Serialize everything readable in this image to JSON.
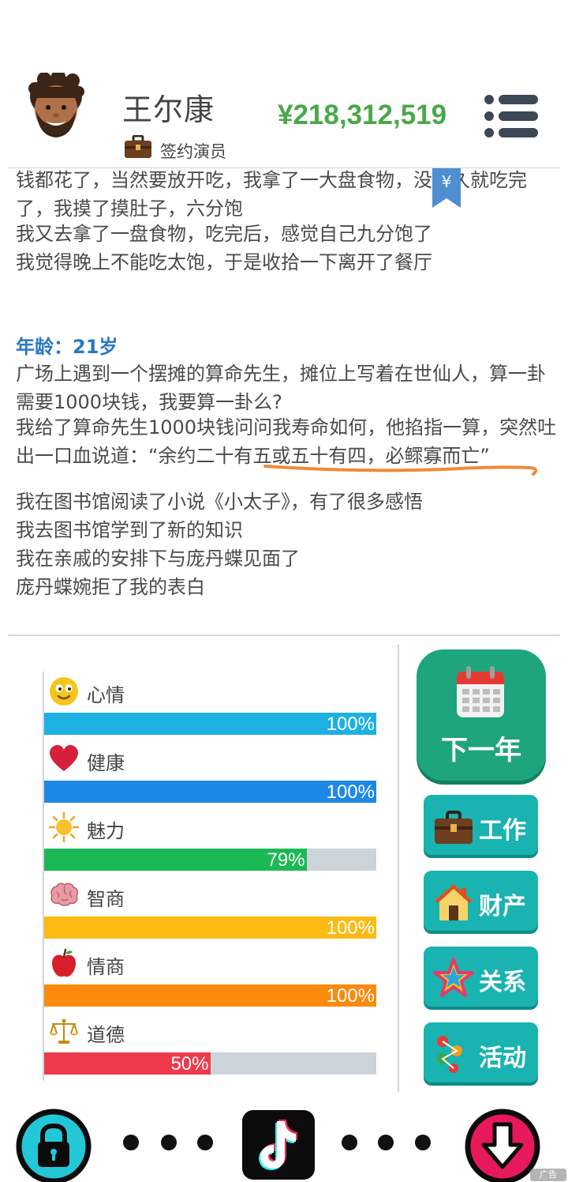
{
  "header": {
    "name": "王尔康",
    "job": "签约演员",
    "money": "¥218,312,519"
  },
  "log": {
    "bookmark_symbol": "¥",
    "line1": "钱都花了，当然要放开吃，我拿了一大盘食物，没多久就吃完了，我摸了摸肚子，六分饱",
    "line2": "我又去拿了一盘食物，吃完后，感觉自己九分饱了",
    "line3": "我觉得晚上不能吃太饱，于是收拾一下离开了餐厅",
    "age_label": "年龄：21岁",
    "line4": "广场上遇到一个摆摊的算命先生，摊位上写着在世仙人，算一卦需要1000块钱，我要算一卦么?",
    "line5": "我给了算命先生1000块钱问问我寿命如何，他掐指一算，突然吐出一口血说道：“余约二十有五或五十有四，必鳏寡而亡”",
    "line6": "我在图书馆阅读了小说《小太子》，有了很多感悟",
    "line7": "我去图书馆学到了新的知识",
    "line8": "我在亲戚的安排下与庞丹蝶见面了",
    "line9": "庞丹蝶婉拒了我的表白"
  },
  "stats": [
    {
      "key": "mood",
      "label": "心情",
      "value_text": "100%",
      "value": 100,
      "color": "#1eb0e0",
      "icon": "smiley-icon"
    },
    {
      "key": "health",
      "label": "健康",
      "value_text": "100%",
      "value": 100,
      "color": "#1e88e5",
      "icon": "heart-icon"
    },
    {
      "key": "charm",
      "label": "魅力",
      "value_text": "79%",
      "value": 79,
      "color": "#1bb954",
      "icon": "sun-icon"
    },
    {
      "key": "iq",
      "label": "智商",
      "value_text": "100%",
      "value": 100,
      "color": "#fbbb13",
      "icon": "brain-icon"
    },
    {
      "key": "eq",
      "label": "情商",
      "value_text": "100%",
      "value": 100,
      "color": "#fb8a0d",
      "icon": "apple-icon"
    },
    {
      "key": "morality",
      "label": "道德",
      "value_text": "50%",
      "value": 50,
      "color": "#ef3a4c",
      "icon": "scales-icon"
    }
  ],
  "actions": {
    "next_year": "下一年",
    "work": "工作",
    "property": "财产",
    "relations": "关系",
    "activities": "活动"
  },
  "ad_label": "广告",
  "colors": {
    "money": "#4aa84a",
    "age_label": "#2a78c2",
    "next_year_bg": "#1fa57e",
    "side_button_bg": "#19b3b1"
  }
}
